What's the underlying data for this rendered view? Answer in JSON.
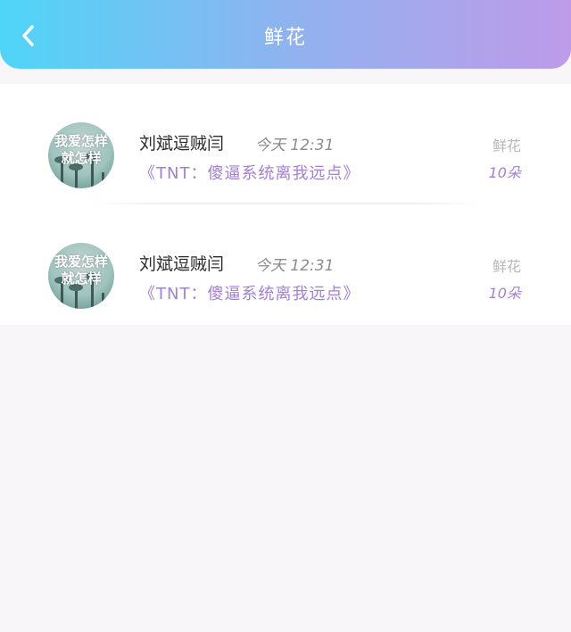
{
  "header": {
    "title": "鲜花",
    "back_icon": "chevron-left-icon",
    "gradient_colors": [
      "#4fd5f8",
      "#be9be9"
    ]
  },
  "list": {
    "items": [
      {
        "avatar_text_line1": "我爱怎样",
        "avatar_text_line2": "就怎样",
        "sender": "刘斌逗贼闫",
        "time": "今天 12:31",
        "song": "《TNT：傻逼系统离我远点》",
        "gift_name": "鲜花",
        "gift_count": "10朵"
      },
      {
        "avatar_text_line1": "我爱怎样",
        "avatar_text_line2": "就怎样",
        "sender": "刘斌逗贼闫",
        "time": "今天 12:31",
        "song": "《TNT：傻逼系统离我远点》",
        "gift_name": "鲜花",
        "gift_count": "10朵"
      }
    ]
  },
  "colors": {
    "accent_purple": "#a37fd8",
    "muted_gray": "#b8b8b8"
  }
}
